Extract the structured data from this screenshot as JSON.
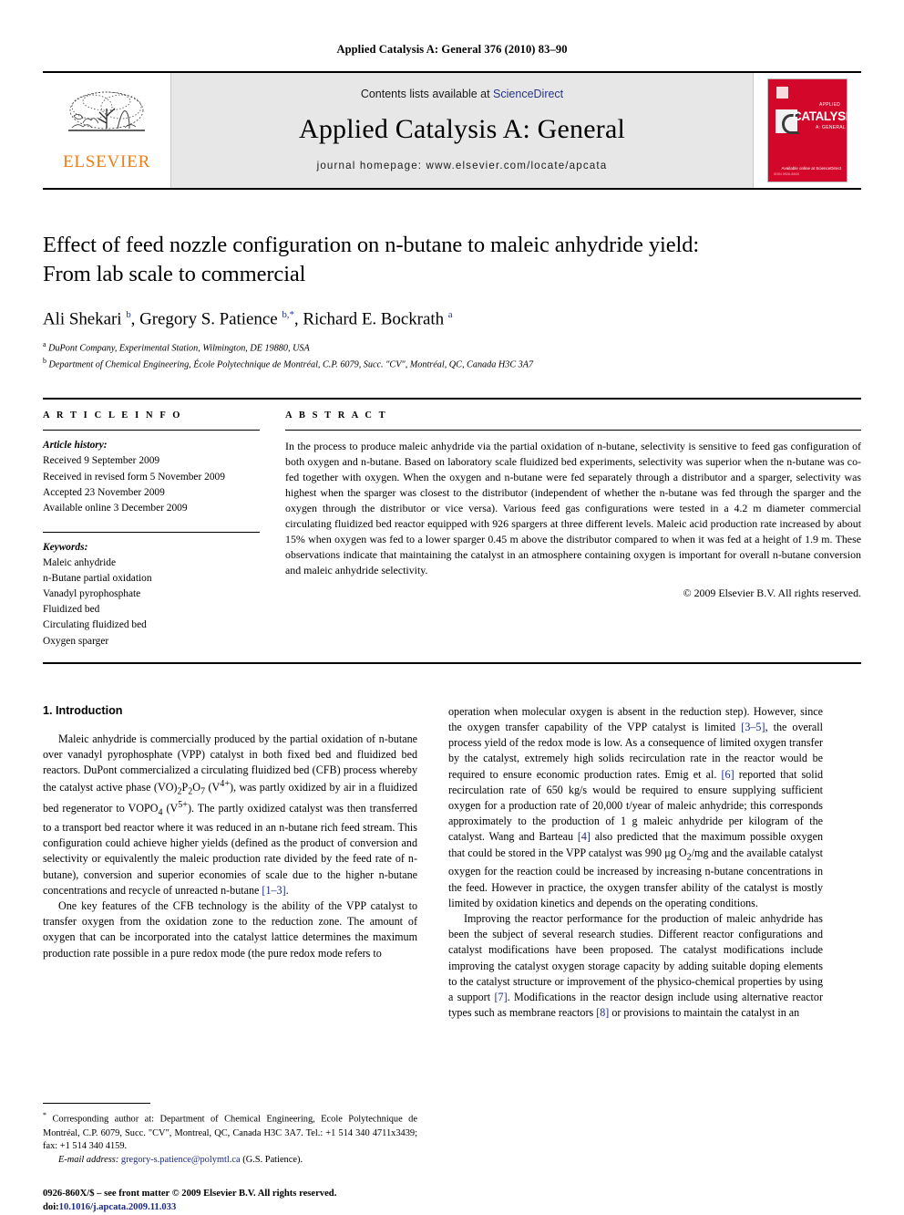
{
  "running_head": "Applied Catalysis A: General 376 (2010) 83–90",
  "masthead": {
    "contents_prefix": "Contents lists available at ",
    "sciencedirect": "ScienceDirect",
    "journal_name": "Applied Catalysis A: General",
    "homepage": "journal homepage: www.elsevier.com/locate/apcata",
    "publisher_logo_text": "ELSEVIER",
    "cover": {
      "title": "CATALYSIS",
      "superscript": "APPLIED",
      "subscript": "A: GENERAL",
      "footer": "Available online at\nScienceDirect",
      "bottom_left": "ISSN 0926-860X"
    },
    "accent_link_color": "#28348a",
    "brand_orange": "#ef7d1a",
    "cover_red": "#d3072a",
    "band_gray": "#e7e7e7"
  },
  "article": {
    "title_line1": "Effect of feed nozzle configuration on n-butane to maleic anhydride yield:",
    "title_line2": "From lab scale to commercial",
    "authors_html": "Ali Shekari <sup>b</sup>, Gregory S. Patience <sup>b,*</sup>, Richard E. Bockrath <sup>a</sup>",
    "affiliation_a": "DuPont Company, Experimental Station, Wilmington, DE 19880, USA",
    "affiliation_b": "Department of Chemical Engineering, École Polytechnique de Montréal, C.P. 6079, Succ. \"CV\", Montréal, QC, Canada H3C 3A7"
  },
  "info": {
    "heading": "A R T I C L E   I N F O",
    "history_label": "Article history:",
    "history": [
      "Received 9 September 2009",
      "Received in revised form 5 November 2009",
      "Accepted 23 November 2009",
      "Available online 3 December 2009"
    ],
    "keywords_label": "Keywords:",
    "keywords": [
      "Maleic anhydride",
      "n-Butane partial oxidation",
      "Vanadyl pyrophosphate",
      "Fluidized bed",
      "Circulating fluidized bed",
      "Oxygen sparger"
    ]
  },
  "abstract": {
    "heading": "A B S T R A C T",
    "text": "In the process to produce maleic anhydride via the partial oxidation of n-butane, selectivity is sensitive to feed gas configuration of both oxygen and n-butane. Based on laboratory scale fluidized bed experiments, selectivity was superior when the n-butane was co-fed together with oxygen. When the oxygen and n-butane were fed separately through a distributor and a sparger, selectivity was highest when the sparger was closest to the distributor (independent of whether the n-butane was fed through the sparger and the oxygen through the distributor or vice versa). Various feed gas configurations were tested in a 4.2 m diameter commercial circulating fluidized bed reactor equipped with 926 spargers at three different levels. Maleic acid production rate increased by about 15% when oxygen was fed to a lower sparger 0.45 m above the distributor compared to when it was fed at a height of 1.9 m. These observations indicate that maintaining the catalyst in an atmosphere containing oxygen is important for overall n-butane conversion and maleic anhydride selectivity.",
    "copyright": "© 2009 Elsevier B.V. All rights reserved."
  },
  "body": {
    "section_heading": "1. Introduction",
    "left_p1_html": "Maleic anhydride is commercially produced by the partial oxidation of n-butane over vanadyl pyrophosphate (VPP) catalyst in both fixed bed and fluidized bed reactors. DuPont commercialized a circulating fluidized bed (CFB) process whereby the catalyst active phase (VO)<sub>2</sub>P<sub>2</sub>O<sub>7</sub> (V<sup>4+</sup>), was partly oxidized by air in a fluidized bed regenerator to VOPO<sub>4</sub> (V<sup>5+</sup>). The partly oxidized catalyst was then transferred to a transport bed reactor where it was reduced in an n-butane rich feed stream. This configuration could achieve higher yields (defined as the product of conversion and selectivity or equivalently the maleic production rate divided by the feed rate of n-butane), conversion and superior economies of scale due to the higher n-butane concentrations and recycle of unreacted n-butane <a class=\"ref\">[1–3]</a>.",
    "left_p2_html": "One key features of the CFB technology is the ability of the VPP catalyst to transfer oxygen from the oxidation zone to the reduction zone. The amount of oxygen that can be incorporated into the catalyst lattice determines the maximum production rate possible in a pure redox mode (the pure redox mode refers to",
    "right_p1_html": "operation when molecular oxygen is absent in the reduction step). However, since the oxygen transfer capability of the VPP catalyst is limited <a class=\"ref\">[3–5]</a>, the overall process yield of the redox mode is low. As a consequence of limited oxygen transfer by the catalyst, extremely high solids recirculation rate in the reactor would be required to ensure economic production rates. Emig et al. <a class=\"ref\">[6]</a> reported that solid recirculation rate of 650 kg/s would be required to ensure supplying sufficient oxygen for a production rate of 20,000 t/year of maleic anhydride; this corresponds approximately to the production of 1 g maleic anhydride per kilogram of the catalyst. Wang and Barteau <a class=\"ref\">[4]</a> also predicted that the maximum possible oxygen that could be stored in the VPP catalyst was 990 μg O<sub>2</sub>/mg and the available catalyst oxygen for the reaction could be increased by increasing n-butane concentrations in the feed. However in practice, the oxygen transfer ability of the catalyst is mostly limited by oxidation kinetics and depends on the operating conditions.",
    "right_p2_html": "Improving the reactor performance for the production of maleic anhydride has been the subject of several research studies. Different reactor configurations and catalyst modifications have been proposed. The catalyst modifications include improving the catalyst oxygen storage capacity by adding suitable doping elements to the catalyst structure or improvement of the physico-chemical properties by using a support <a class=\"ref\">[7]</a>. Modifications in the reactor design include using alternative reactor types such as membrane reactors <a class=\"ref\">[8]</a> or provisions to maintain the catalyst in an"
  },
  "footnotes": {
    "corresponding_html": "<span class=\"fn-star\">*</span> Corresponding author at: Department of Chemical Engineering, Ecole Polytechnique de Montréal, C.P. 6079, Succ. \"CV\", Montreal, QC, Canada H3C 3A7. Tel.: +1 514 340 4711x3439; fax: +1 514 340 4159.",
    "email_label": "E-mail address:",
    "email": "gregory-s.patience@polymtl.ca",
    "email_owner": "(G.S. Patience).",
    "issn_line": "0926-860X/$ – see front matter © 2009 Elsevier B.V. All rights reserved.",
    "doi_label": "doi:",
    "doi": "10.1016/j.apcata.2009.11.033"
  }
}
